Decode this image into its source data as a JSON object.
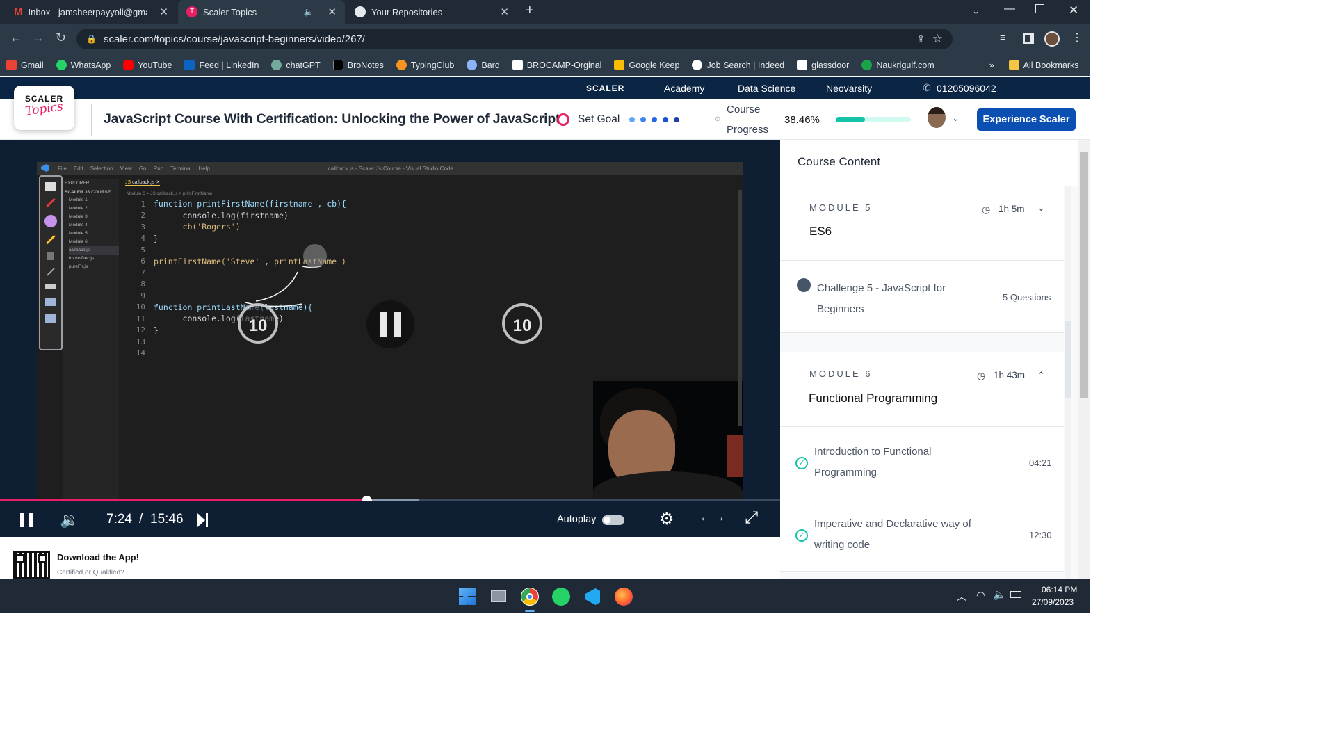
{
  "browser": {
    "tabs": [
      {
        "title": "Inbox - jamsheerpayyoli@gmail.",
        "active": false
      },
      {
        "title": "Scaler Topics",
        "active": true
      },
      {
        "title": "Your Repositories",
        "active": false
      }
    ],
    "url": "scaler.com/topics/course/javascript-beginners/video/267/",
    "bookmarks": [
      "Gmail",
      "WhatsApp",
      "YouTube",
      "Feed | LinkedIn",
      "chatGPT",
      "BroNotes",
      "TypingClub",
      "Bard",
      "BROCAMP-Orginal",
      "Google Keep",
      "Job Search | Indeed",
      "glassdoor",
      "Naukrigulf.com"
    ],
    "all_bookmarks": "All Bookmarks",
    "more_bookmarks": "»"
  },
  "site": {
    "nav": {
      "brand": "SCALER",
      "items": [
        "Academy",
        "Data Science",
        "Neovarsity"
      ],
      "phone": "01205096042"
    },
    "logo": {
      "line1": "SCALER",
      "line2": "Topics"
    },
    "course_title": "JavaScript Course With Certification: Unlocking the Power of JavaScript",
    "set_goal": "Set Goal",
    "progress_label_1": "Course",
    "progress_label_2": "Progress",
    "progress_percent": "38.46%",
    "progress_fraction": 0.3846,
    "cta": "Experience Scaler"
  },
  "video": {
    "vscode_menu": [
      "File",
      "Edit",
      "Selection",
      "View",
      "Go",
      "Run",
      "Terminal",
      "Help"
    ],
    "vscode_title": "callback.js - Scaler Js Course - Visual Studio Code",
    "explorer_title": "EXPLORER",
    "explorer_root": "SCALER JS COURSE",
    "explorer_items": [
      "Module 1",
      "Module 2",
      "Module 3",
      "Module 4",
      "Module 5",
      "Module 6",
      "callback.js",
      "impVsDec.js",
      "pureFn.js"
    ],
    "editor_tab": "callback.js",
    "breadcrumb": "Module 6 > JS callback.js > printFirstName",
    "code_lines": [
      "function printFirstName(firstname , cb){",
      "      console.log(firstname)",
      "      cb('Rogers')",
      "}",
      "",
      "printFirstName('Steve' , printLastName )",
      "",
      "",
      "",
      "function printLastName(lastname){",
      "      console.log(lastname)",
      "}",
      "",
      ""
    ],
    "skip_back": "10",
    "skip_forward": "10",
    "current_time": "7:24",
    "separator": "/",
    "duration": "15:46",
    "played_fraction": 0.4695,
    "buffered_fraction": 0.537,
    "autoplay_label": "Autoplay",
    "autoplay_on": false
  },
  "course_content": {
    "title": "Course Content",
    "module5": {
      "label": "MODULE 5",
      "duration": "1h 5m",
      "name": "ES6"
    },
    "challenge": {
      "title": "Challenge 5 - JavaScript for Beginners",
      "meta": "5 Questions"
    },
    "module6": {
      "label": "MODULE 6",
      "duration": "1h 43m",
      "name": "Functional Programming"
    },
    "lessons": [
      {
        "title": "Introduction to Functional Programming",
        "duration": "04:21"
      },
      {
        "title": "Imperative and Declarative way of writing code",
        "duration": "12:30"
      }
    ]
  },
  "app_promo": {
    "title": "Download the App!",
    "subtitle": "Certified or Qualified?"
  },
  "taskbar": {
    "time": "06:14 PM",
    "date": "27/09/2023"
  },
  "colors": {
    "accent_pink": "#e91e63",
    "brand_blue": "#0b4fb3",
    "progress_teal": "#14c3a8",
    "nav_dark": "#0b2545"
  }
}
